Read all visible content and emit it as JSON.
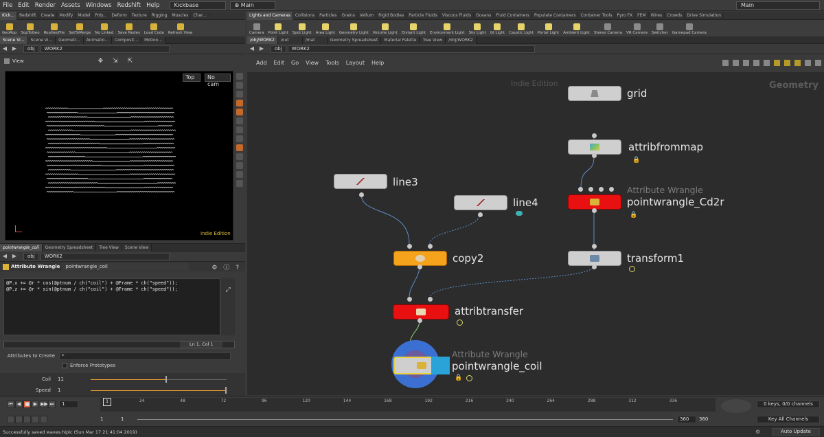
{
  "menubar": {
    "items": [
      "File",
      "Edit",
      "Render",
      "Assets",
      "Windows",
      "Redshift",
      "Help"
    ],
    "desktop": "Kickbase",
    "context": "Main",
    "right_context": "Main"
  },
  "shelf_left": {
    "tabs": [
      "Kick...",
      "Redshift",
      "Create",
      "Modify",
      "Model",
      "Poly...",
      "Deform",
      "Texture",
      "Rigging",
      "Muscles",
      "Char..."
    ],
    "tools": [
      "GeoRop",
      "SopToGeo",
      "RopGeoFile",
      "SetToMerge",
      "No Linked",
      "Save Nodes",
      "Load Code",
      "Refresh View"
    ]
  },
  "shelf_right": {
    "tabs": [
      "Lights and Cameras",
      "Collisions",
      "Particles",
      "Grains",
      "Vellum",
      "Rigid Bodies",
      "Particle Fluids",
      "Viscous Fluids",
      "Oceans",
      "Fluid Containers",
      "Populate Containers",
      "Container Tools",
      "Pyro FX",
      "FEM",
      "Wires",
      "Crowds",
      "Drive Simulation"
    ],
    "tools": [
      "Camera",
      "Point Light",
      "Spot Light",
      "Area Light",
      "Geometry Light",
      "Volume Light",
      "Distant Light",
      "Environment Light",
      "Sky Light",
      "GI Light",
      "Caustic Light",
      "Portal Light",
      "Ambient Light",
      "Stereo Camera",
      "VR Camera",
      "Switcher",
      "Gamepad Camera"
    ]
  },
  "viewer": {
    "tabs": [
      "Scene Vi...",
      "Scene Vi...",
      "Geometr...",
      "Animatio...",
      "Composit...",
      "Motion..."
    ],
    "path": [
      "obj",
      "WORK2"
    ],
    "title": "View",
    "view_top": "Top",
    "camera": "No cam",
    "watermark": "Indie Edition",
    "coil_rows": [
      "(((((((((((((((((((((((((((((((((((((((((((((((((((((((",
      "(((((((((((((((((((((((((((((((((((((((((((((((((((((((("
    ]
  },
  "params": {
    "tabs": [
      "pointwrangle_coil",
      "Geometry Spreadsheet",
      "Tree View",
      "Scene View"
    ],
    "path": [
      "obj",
      "WORK2"
    ],
    "node_type": "Attribute Wrangle",
    "node_name": "pointwrangle_coil",
    "code_line1": "@P.x += @r * cos(@ptnum / ch(\"coil\") + @Frame * ch(\"speed\"));",
    "code_line2": "@P.z += @r * sin(@ptnum / ch(\"coil\") + @Frame * ch(\"speed\"));",
    "cursor": "Ln 1, Col 1",
    "attributes_label": "Attributes to Create",
    "attributes_value": "*",
    "enforce_label": "Enforce Prototypes",
    "coil_label": "Coil",
    "coil_value": "11",
    "coil_fraction": 0.55,
    "speed_label": "Speed",
    "speed_value": "1",
    "speed_fraction": 1.0
  },
  "network": {
    "tabs": [
      "/obj/WORK2",
      "/out",
      "/mat",
      "Geometry Spreadsheet",
      "Material Palette",
      "Tree View",
      "/obj/WORK2"
    ],
    "path": [
      "obj",
      "WORK2"
    ],
    "menu": [
      "Add",
      "Edit",
      "Go",
      "View",
      "Tools",
      "Layout",
      "Help"
    ],
    "watermark": "Indie Edition",
    "context_label": "Geometry",
    "nodes": {
      "grid": "grid",
      "attribfrommap": "attribfrommap",
      "line3": "line3",
      "line4": "line4",
      "wrangle_cd_type": "Attribute Wrangle",
      "wrangle_cd": "pointwrangle_Cd2r",
      "copy2": "copy2",
      "transform1": "transform1",
      "attribtransfer": "attribtransfer",
      "wrangle_coil_type": "Attribute Wrangle",
      "wrangle_coil": "pointwrangle_coil"
    }
  },
  "timeline": {
    "frame": "1",
    "ticks": [
      "1",
      "24",
      "48",
      "72",
      "96",
      "120",
      "144",
      "168",
      "192",
      "216",
      "240",
      "264",
      "288",
      "312",
      "336"
    ],
    "start": "1",
    "start2": "1",
    "end": "360",
    "end2": "360",
    "keys": "0 keys, 0/0 channels",
    "key_channels": "Key All Channels"
  },
  "status": {
    "message": "Successfully saved waves.hiplc (Sun Mar 17 21:41:04 2019)",
    "auto_update": "Auto Update"
  },
  "colors": {
    "copy_node": "#f5a21c",
    "wrangle_node": "#e81010",
    "coil_node": "#3b6fd1"
  }
}
